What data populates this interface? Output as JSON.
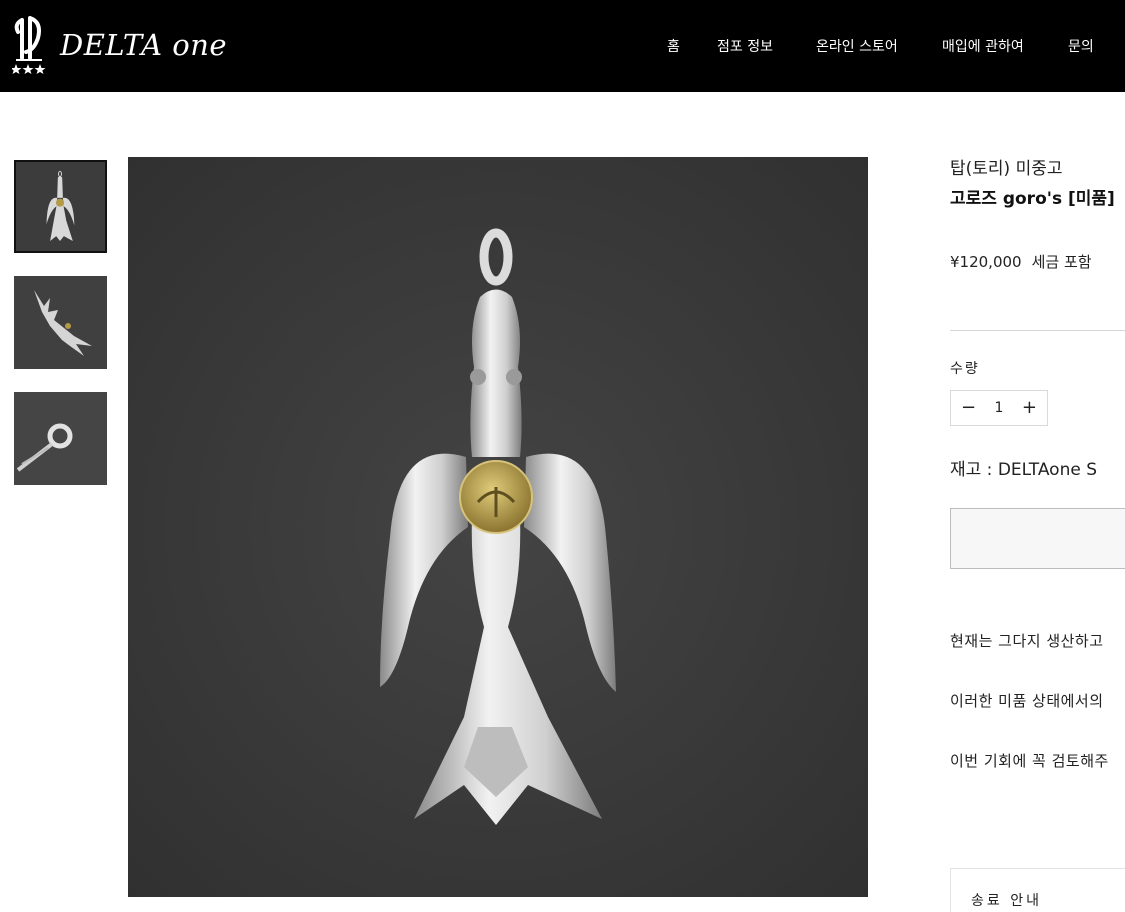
{
  "brand": {
    "name": "DELTA one",
    "logo_mark": "DELTA-monogram-logo-with-three-stars"
  },
  "nav": {
    "items": [
      {
        "label": "홈"
      },
      {
        "label": "점포 정보"
      },
      {
        "label": "온라인 스토어"
      },
      {
        "label": "매입에 관하여"
      },
      {
        "label": "문의"
      }
    ]
  },
  "gallery": {
    "thumbnails": [
      {
        "icon": "eagle-pendant-front-thumbnail"
      },
      {
        "icon": "eagle-pendant-side-thumbnail"
      },
      {
        "icon": "eagle-pendant-bail-closeup-thumbnail"
      }
    ],
    "main_image_icon": "silver-eagle-pendant-with-gold-disc-photo"
  },
  "product": {
    "category": "탑(토리) 미중고",
    "title": "고로즈 goro's [미품]",
    "price": "¥120,000",
    "tax_note": "세금 포함",
    "quantity_label": "수량",
    "quantity": "1",
    "quantity_minus": "−",
    "quantity_plus": "+",
    "stock": "재고 : DELTAone S",
    "description": [
      "현재는 그다지 생산하고",
      "이러한 미품 상태에서의",
      "이번 기회에 꼭 검토해주"
    ],
    "shipping_label": "송료 안내"
  },
  "colors": {
    "header_bg": "#000000",
    "photo_bg": "#3b3b3b",
    "silver": "#d9d9d9",
    "gold": "#b39a45"
  }
}
